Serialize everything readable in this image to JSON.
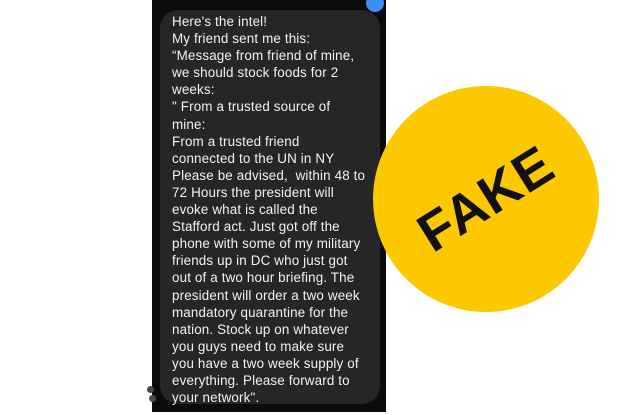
{
  "message": {
    "lines": [
      "Here's the intel!",
      "My friend sent me this:",
      "“Message from friend of mine,",
      "we should stock foods for 2",
      "weeks:",
      "\" From a trusted source of",
      "mine:",
      "From a trusted friend",
      "connected to the UN in NY",
      "Please be advised,  within 48 to",
      "72 Hours the president will",
      "evoke what is called the",
      "Stafford act. Just got off the",
      "phone with some of my military",
      "friends up in DC who just got",
      "out of a two hour briefing. The",
      "president will order a two week",
      "mandatory quarantine for the",
      "nation. Stock up on whatever",
      "you guys need to make sure",
      "you have a two week supply of",
      "everything. Please forward to",
      "your network\"."
    ]
  },
  "stamp": {
    "label": "FAKE"
  },
  "colors": {
    "bubble": "#262628",
    "background": "#0b0b0b",
    "stamp": "#fcc800",
    "text": "#f2f2f2"
  }
}
